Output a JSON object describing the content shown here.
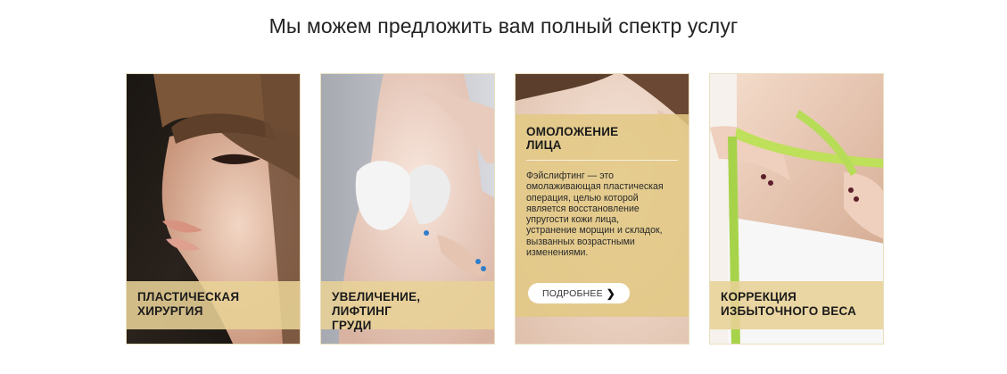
{
  "section": {
    "title": "Мы можем предложить вам полный спектр услуг"
  },
  "cards": [
    {
      "title_line1": "ПЛАСТИЧЕСКАЯ",
      "title_line2": "ХИРУРГИЯ"
    },
    {
      "title_line1": "УВЕЛИЧЕНИЕ, ЛИФТИНГ",
      "title_line2": "ГРУДИ"
    },
    {
      "title_line1": "ОМОЛОЖЕНИЕ",
      "title_line2": "ЛИЦА",
      "description_lines": [
        "Фэйслифтинг — это",
        "омолаживающая пластическая",
        "операция, целью которой",
        "является восстановление",
        "упругости кожи лица,",
        "устранение морщин и складок,",
        "вызванных возрастными",
        "изменениями."
      ],
      "button_label": "ПОДРОБНЕЕ",
      "button_icon": "chevron-right-icon"
    },
    {
      "title_line1": "КОРРЕКЦИЯ",
      "title_line2": "ИЗБЫТОЧНОГО ВЕСА"
    }
  ],
  "colors": {
    "accent_band": "#e8d296",
    "overlay": "#e2c882",
    "card_border": "#e9dfc0"
  }
}
